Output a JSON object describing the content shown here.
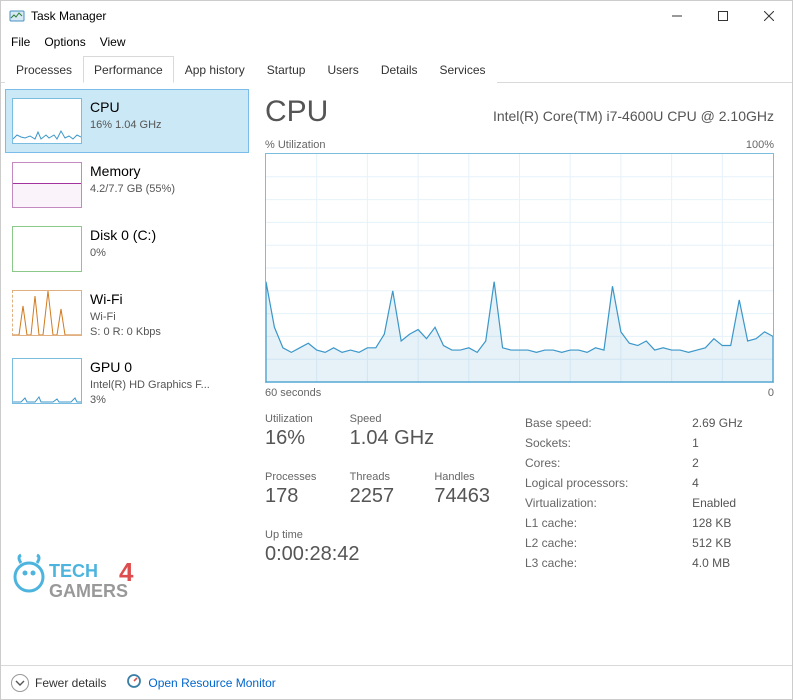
{
  "window": {
    "title": "Task Manager"
  },
  "menu": {
    "file": "File",
    "options": "Options",
    "view": "View"
  },
  "tabs": {
    "processes": "Processes",
    "performance": "Performance",
    "apphistory": "App history",
    "startup": "Startup",
    "users": "Users",
    "details": "Details",
    "services": "Services"
  },
  "sidebar": {
    "cpu": {
      "name": "CPU",
      "sub": "16%  1.04 GHz",
      "thumb_color": "#3c97c9"
    },
    "memory": {
      "name": "Memory",
      "sub": "4.2/7.7 GB (55%)",
      "thumb_color": "#a3339f"
    },
    "disk": {
      "name": "Disk 0 (C:)",
      "sub": "0%",
      "thumb_color": "#4ca64c"
    },
    "wifi": {
      "name": "Wi-Fi",
      "sub1": "Wi-Fi",
      "sub2": "S: 0  R: 0 Kbps",
      "thumb_color": "#d17a1f"
    },
    "gpu": {
      "name": "GPU 0",
      "sub1": "Intel(R) HD Graphics F...",
      "sub2": "3%",
      "thumb_color": "#3c97c9"
    }
  },
  "main": {
    "title": "CPU",
    "model": "Intel(R) Core(TM) i7-4600U CPU @ 2.10GHz",
    "util_label": "% Utilization",
    "util_max": "100%",
    "time_left": "60 seconds",
    "time_right": "0"
  },
  "stats": {
    "utilization": {
      "label": "Utilization",
      "value": "16%"
    },
    "speed": {
      "label": "Speed",
      "value": "1.04 GHz"
    },
    "processes": {
      "label": "Processes",
      "value": "178"
    },
    "threads": {
      "label": "Threads",
      "value": "2257"
    },
    "handles": {
      "label": "Handles",
      "value": "74463"
    },
    "uptime": {
      "label": "Up time",
      "value": "0:00:28:42"
    }
  },
  "info": {
    "base_speed": {
      "label": "Base speed:",
      "value": "2.69 GHz"
    },
    "sockets": {
      "label": "Sockets:",
      "value": "1"
    },
    "cores": {
      "label": "Cores:",
      "value": "2"
    },
    "lprocs": {
      "label": "Logical processors:",
      "value": "4"
    },
    "virt": {
      "label": "Virtualization:",
      "value": "Enabled"
    },
    "l1": {
      "label": "L1 cache:",
      "value": "128 KB"
    },
    "l2": {
      "label": "L2 cache:",
      "value": "512 KB"
    },
    "l3": {
      "label": "L3 cache:",
      "value": "4.0 MB"
    }
  },
  "chart_data": {
    "type": "area",
    "title": "% Utilization",
    "xlabel": "seconds ago",
    "ylabel": "% Utilization",
    "ylim": [
      0,
      100
    ],
    "x_range_seconds": [
      60,
      0
    ],
    "values_pct": [
      44,
      24,
      15,
      13,
      15,
      17,
      14,
      13,
      15,
      13,
      14,
      13,
      15,
      15,
      21,
      40,
      18,
      21,
      23,
      19,
      24,
      16,
      14,
      14,
      15,
      13,
      18,
      44,
      15,
      14,
      14,
      14,
      13,
      14,
      14,
      13,
      14,
      14,
      13,
      15,
      14,
      42,
      22,
      17,
      16,
      18,
      14,
      15,
      14,
      14,
      13,
      14,
      15,
      19,
      16,
      16,
      36,
      18,
      19,
      22,
      20
    ]
  },
  "footer": {
    "fewer": "Fewer details",
    "orm": "Open Resource Monitor"
  },
  "watermark": "TECH 4 GAMERS"
}
